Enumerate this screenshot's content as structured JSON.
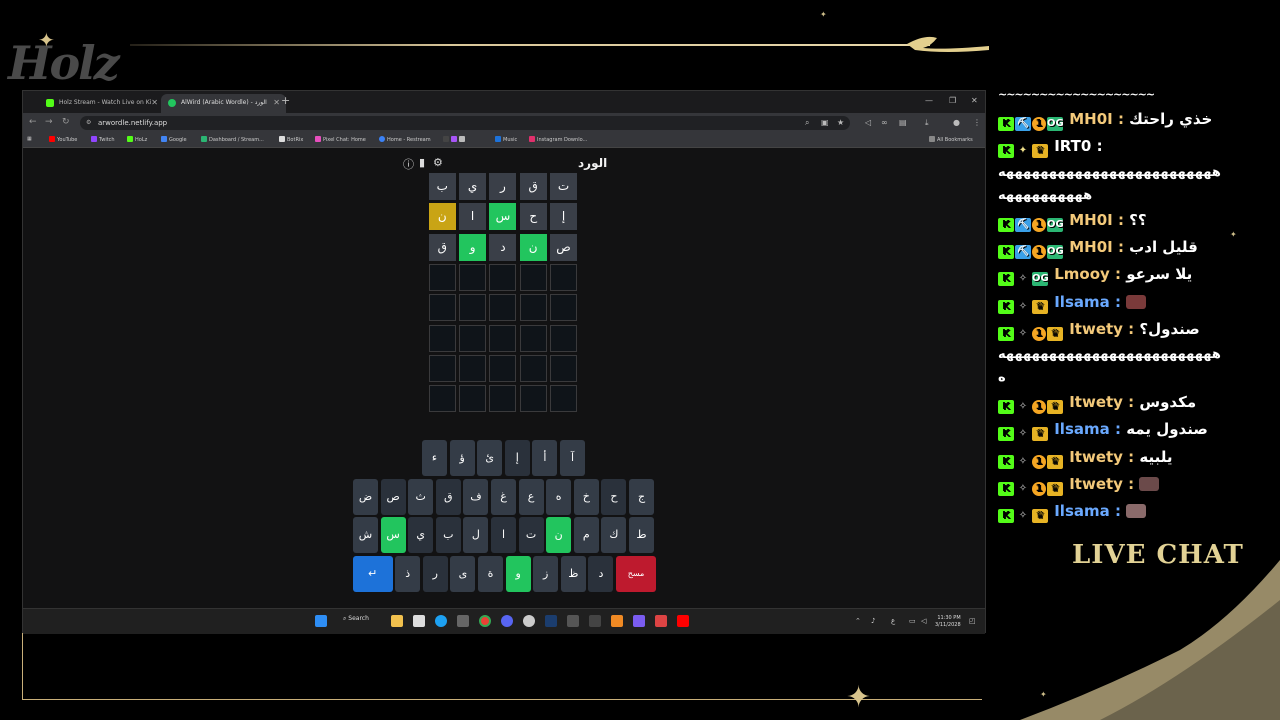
{
  "overlay": {
    "logo_text": "Holz",
    "live_chat_label": "LIVE CHAT"
  },
  "browser": {
    "tabs": [
      {
        "title": "Holz Stream - Watch Live on Ki",
        "active": false
      },
      {
        "title": "AlWird (Arabic Wordle) - الورد",
        "active": true
      }
    ],
    "url": "arwordle.netlify.app",
    "bookmarks": [
      "YouTube",
      "Twitch",
      "HoLz",
      "Google",
      "Dashboard / Stream...",
      "BotRix",
      "Pixel Chat: Home",
      "Home - Restream",
      "Music",
      "Instagram Downlo..."
    ],
    "all_bookmarks": "All Bookmarks"
  },
  "game": {
    "title": "الورد",
    "icons": [
      "help-icon",
      "stats-icon",
      "settings-icon"
    ],
    "grid": [
      [
        {
          "l": "ت",
          "s": "absent"
        },
        {
          "l": "ق",
          "s": "absent"
        },
        {
          "l": "ر",
          "s": "absent"
        },
        {
          "l": "ي",
          "s": "absent"
        },
        {
          "l": "ب",
          "s": "absent"
        }
      ],
      [
        {
          "l": "إ",
          "s": "absent"
        },
        {
          "l": "ح",
          "s": "absent"
        },
        {
          "l": "س",
          "s": "correct"
        },
        {
          "l": "ا",
          "s": "absent"
        },
        {
          "l": "ن",
          "s": "present"
        }
      ],
      [
        {
          "l": "ص",
          "s": "absent"
        },
        {
          "l": "ن",
          "s": "correct"
        },
        {
          "l": "د",
          "s": "absent"
        },
        {
          "l": "و",
          "s": "correct"
        },
        {
          "l": "ق",
          "s": "absent"
        }
      ],
      [
        {
          "l": "",
          "s": "empty"
        },
        {
          "l": "",
          "s": "empty"
        },
        {
          "l": "",
          "s": "empty"
        },
        {
          "l": "",
          "s": "empty"
        },
        {
          "l": "",
          "s": "empty"
        }
      ],
      [
        {
          "l": "",
          "s": "empty"
        },
        {
          "l": "",
          "s": "empty"
        },
        {
          "l": "",
          "s": "empty"
        },
        {
          "l": "",
          "s": "empty"
        },
        {
          "l": "",
          "s": "empty"
        }
      ],
      [
        {
          "l": "",
          "s": "empty"
        },
        {
          "l": "",
          "s": "empty"
        },
        {
          "l": "",
          "s": "empty"
        },
        {
          "l": "",
          "s": "empty"
        },
        {
          "l": "",
          "s": "empty"
        }
      ],
      [
        {
          "l": "",
          "s": "empty"
        },
        {
          "l": "",
          "s": "empty"
        },
        {
          "l": "",
          "s": "empty"
        },
        {
          "l": "",
          "s": "empty"
        },
        {
          "l": "",
          "s": "empty"
        }
      ],
      [
        {
          "l": "",
          "s": "empty"
        },
        {
          "l": "",
          "s": "empty"
        },
        {
          "l": "",
          "s": "empty"
        },
        {
          "l": "",
          "s": "empty"
        },
        {
          "l": "",
          "s": "empty"
        }
      ]
    ],
    "keyboard": {
      "row1": [
        {
          "l": "آ",
          "s": "key"
        },
        {
          "l": "أ",
          "s": "key"
        },
        {
          "l": "إ",
          "s": "dark"
        },
        {
          "l": "ئ",
          "s": "key"
        },
        {
          "l": "ؤ",
          "s": "key"
        },
        {
          "l": "ء",
          "s": "key"
        }
      ],
      "row2": [
        {
          "l": "ج",
          "s": "key"
        },
        {
          "l": "ح",
          "s": "dark"
        },
        {
          "l": "خ",
          "s": "key"
        },
        {
          "l": "ه",
          "s": "key"
        },
        {
          "l": "ع",
          "s": "key"
        },
        {
          "l": "غ",
          "s": "key"
        },
        {
          "l": "ف",
          "s": "key"
        },
        {
          "l": "ق",
          "s": "dark"
        },
        {
          "l": "ث",
          "s": "key"
        },
        {
          "l": "ص",
          "s": "dark"
        },
        {
          "l": "ض",
          "s": "key"
        }
      ],
      "row3": [
        {
          "l": "ط",
          "s": "key"
        },
        {
          "l": "ك",
          "s": "key"
        },
        {
          "l": "م",
          "s": "key"
        },
        {
          "l": "ن",
          "s": "correct"
        },
        {
          "l": "ت",
          "s": "dark"
        },
        {
          "l": "ا",
          "s": "dark"
        },
        {
          "l": "ل",
          "s": "key"
        },
        {
          "l": "ب",
          "s": "dark"
        },
        {
          "l": "ي",
          "s": "dark"
        },
        {
          "l": "س",
          "s": "correct"
        },
        {
          "l": "ش",
          "s": "key"
        }
      ],
      "row4": [
        {
          "l": "مسح",
          "s": "delete"
        },
        {
          "l": "د",
          "s": "dark"
        },
        {
          "l": "ظ",
          "s": "key"
        },
        {
          "l": "ز",
          "s": "key"
        },
        {
          "l": "و",
          "s": "correct"
        },
        {
          "l": "ة",
          "s": "key"
        },
        {
          "l": "ى",
          "s": "key"
        },
        {
          "l": "ر",
          "s": "dark"
        },
        {
          "l": "ذ",
          "s": "key"
        },
        {
          "l": "↵",
          "s": "enter"
        }
      ]
    }
  },
  "taskbar": {
    "search_label": "Search",
    "time": "11:30 PM",
    "date": "3/11/2028",
    "lang": "ع"
  },
  "chat": {
    "top_wrap": "~~~~~~~~~~~~~~~~~~~",
    "messages": [
      {
        "user": "MH0I",
        "color": "gold",
        "badges": [
          "k",
          "pick",
          "1",
          "og"
        ],
        "text": "خذي راحتك"
      },
      {
        "user": "IRT0",
        "color": "white",
        "badges": [
          "k",
          "star",
          "crown"
        ],
        "text": ""
      },
      {
        "wrap": "هههههههههههههههههههههههههه"
      },
      {
        "wrap": "ههههههههههه"
      },
      {
        "user": "MH0I",
        "color": "gold",
        "badges": [
          "k",
          "pick",
          "1",
          "og"
        ],
        "text": "؟؟"
      },
      {
        "user": "MH0I",
        "color": "gold",
        "badges": [
          "k",
          "pick",
          "1",
          "og"
        ],
        "text": "قليل ادب"
      },
      {
        "user": "Lmooy",
        "color": "gold",
        "badges": [
          "k",
          "sw",
          "og"
        ],
        "text": "يلا سرعو"
      },
      {
        "user": "Ilsama",
        "color": "blue",
        "badges": [
          "k",
          "sw",
          "crown"
        ],
        "text": "",
        "emote": "#7a3a3a"
      },
      {
        "user": "Itwety",
        "color": "gold",
        "badges": [
          "k",
          "sw",
          "1",
          "crown"
        ],
        "text": "صندول؟"
      },
      {
        "wrap": "هههههههههههههههههههههههههه"
      },
      {
        "wrap": "ه"
      },
      {
        "user": "Itwety",
        "color": "gold",
        "badges": [
          "k",
          "sw",
          "1",
          "crown"
        ],
        "text": "مكدوس"
      },
      {
        "user": "Ilsama",
        "color": "blue",
        "badges": [
          "k",
          "sw",
          "crown"
        ],
        "text": "صندول يمه"
      },
      {
        "user": "Itwety",
        "color": "gold",
        "badges": [
          "k",
          "sw",
          "1",
          "crown"
        ],
        "text": "يلبيه"
      },
      {
        "user": "Itwety",
        "color": "gold",
        "badges": [
          "k",
          "sw",
          "1",
          "crown"
        ],
        "text": "",
        "emote": "#6b4a4a"
      },
      {
        "user": "Ilsama",
        "color": "blue",
        "badges": [
          "k",
          "sw",
          "crown"
        ],
        "text": "",
        "emote": "#8a6a6a"
      }
    ]
  }
}
